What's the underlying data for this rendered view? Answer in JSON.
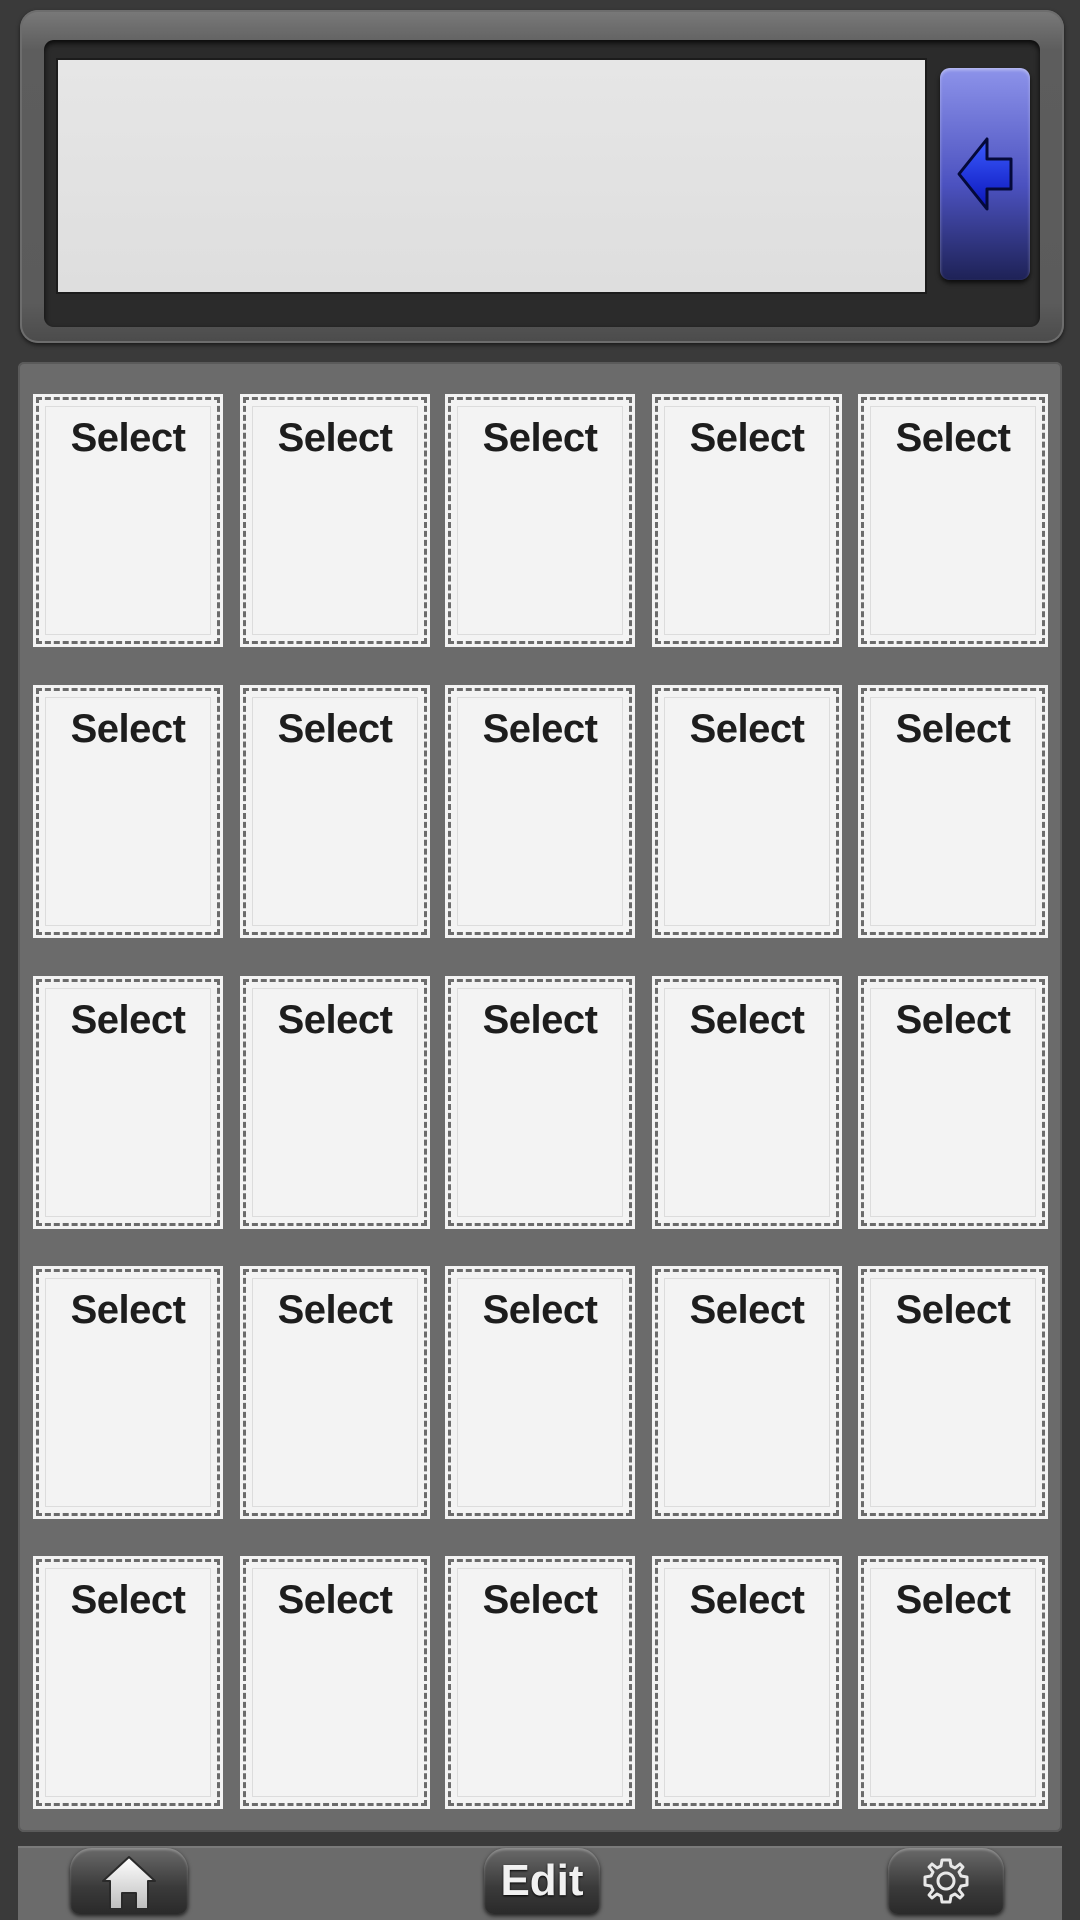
{
  "display": {
    "value": "",
    "placeholder": ""
  },
  "backspace": {
    "icon": "backspace-arrow-icon",
    "color": "#1b2bd6"
  },
  "grid": {
    "rows": 5,
    "columns": 5,
    "cells": [
      [
        "Select",
        "Select",
        "Select",
        "Select",
        "Select"
      ],
      [
        "Select",
        "Select",
        "Select",
        "Select",
        "Select"
      ],
      [
        "Select",
        "Select",
        "Select",
        "Select",
        "Select"
      ],
      [
        "Select",
        "Select",
        "Select",
        "Select",
        "Select"
      ],
      [
        "Select",
        "Select",
        "Select",
        "Select",
        "Select"
      ]
    ]
  },
  "toolbar": {
    "home_icon": "home-icon",
    "edit_label": "Edit",
    "settings_icon": "gear-icon"
  },
  "colors": {
    "background": "#3a3a3a",
    "panel": "#6b6b6b",
    "cell": "#f3f3f3",
    "accent": "#4c52c0"
  }
}
